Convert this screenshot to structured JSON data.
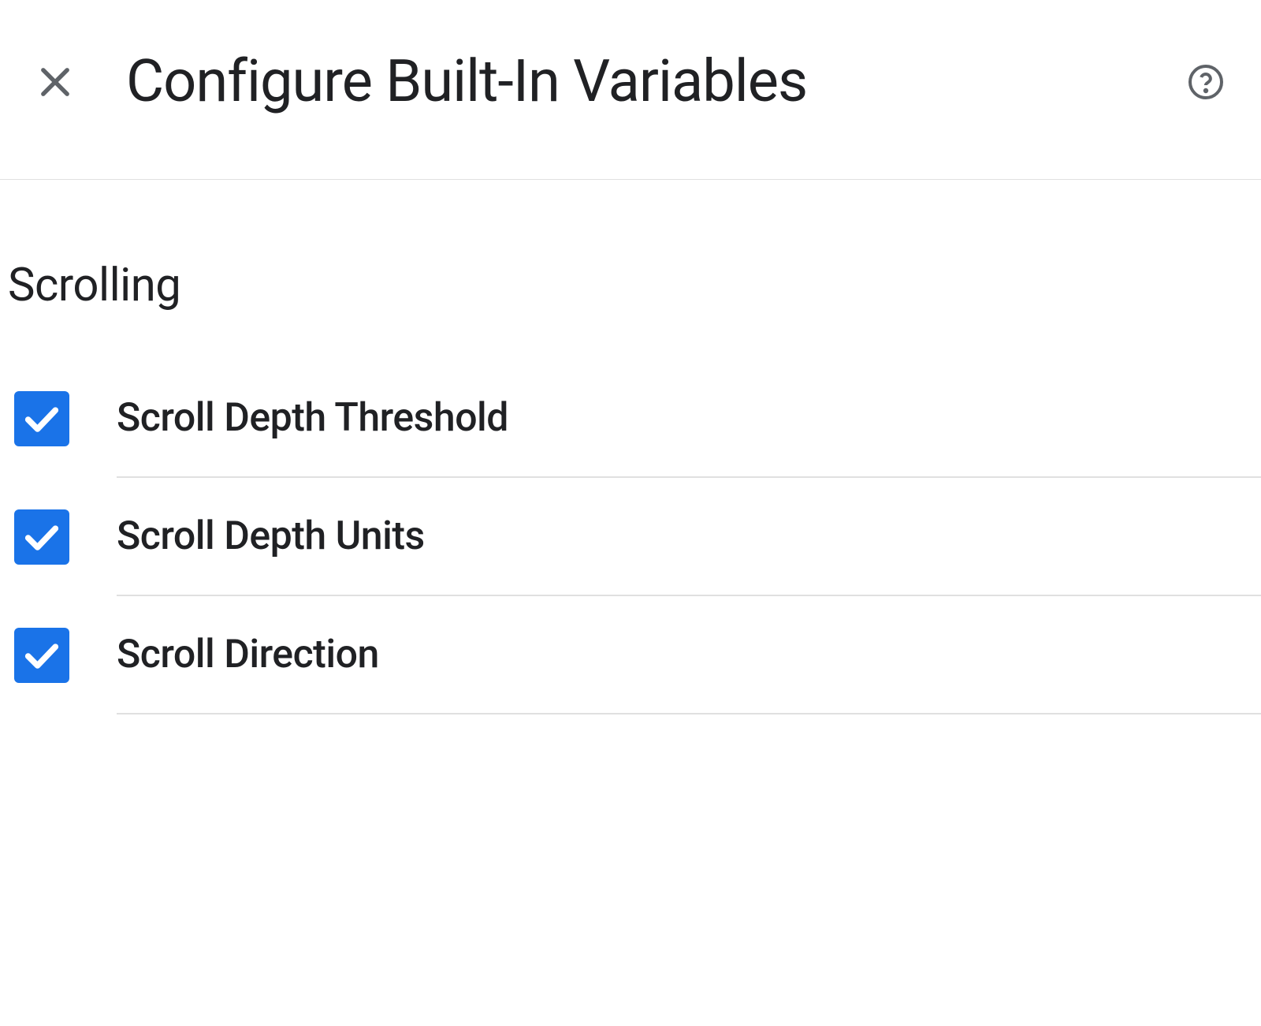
{
  "header": {
    "title": "Configure Built-In Variables"
  },
  "section": {
    "title": "Scrolling",
    "items": [
      {
        "label": "Scroll Depth Threshold",
        "checked": true
      },
      {
        "label": "Scroll Depth Units",
        "checked": true
      },
      {
        "label": "Scroll Direction",
        "checked": true
      }
    ]
  }
}
